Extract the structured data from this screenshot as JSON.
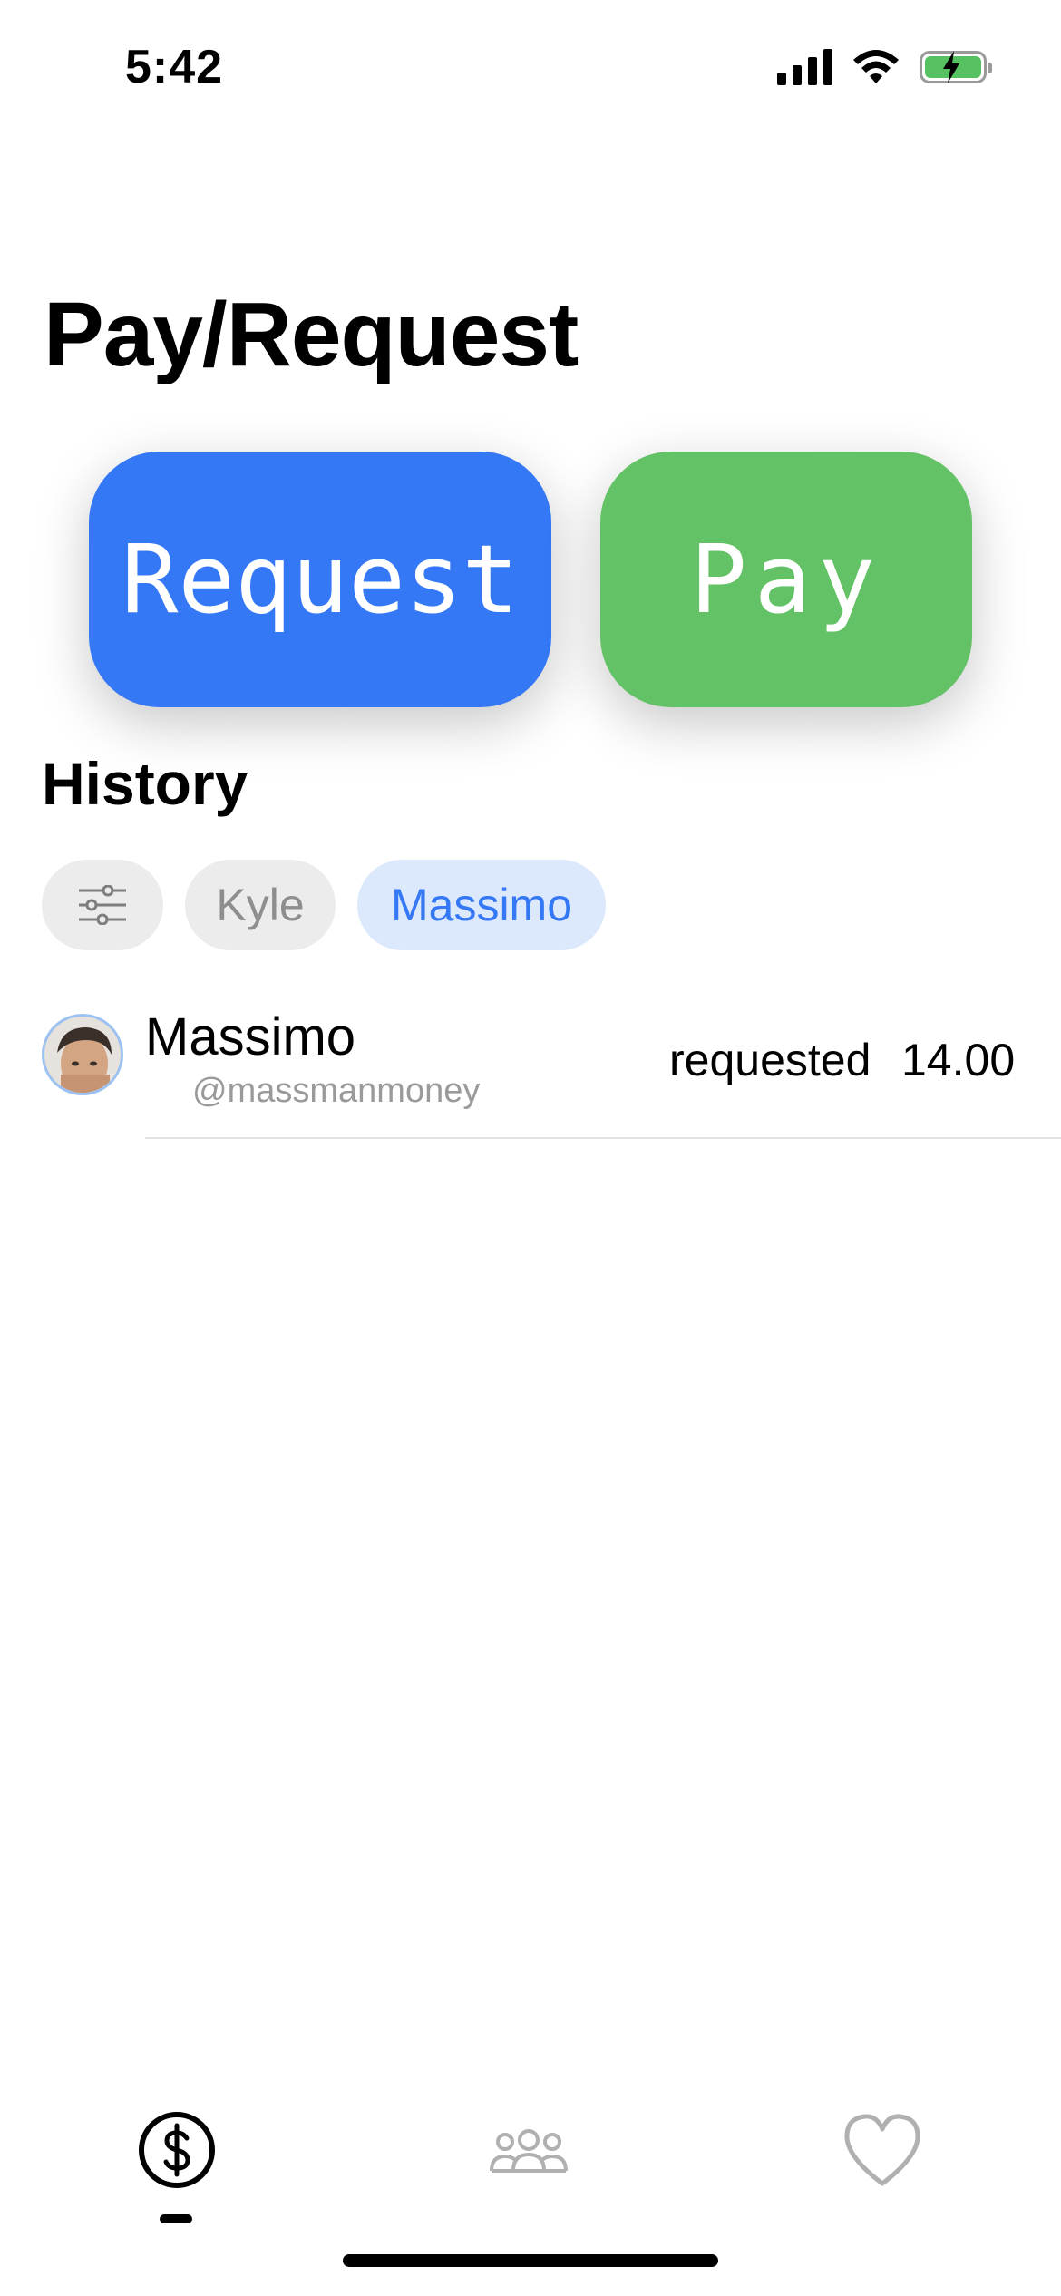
{
  "status_bar": {
    "time": "5:42",
    "icons": [
      "cellular-signal-icon",
      "wifi-icon",
      "battery-charging-icon"
    ],
    "battery_color": "#56c161"
  },
  "header": {
    "title": "Pay/Request"
  },
  "actions": {
    "request_label": "Request",
    "request_color": "#3478f6",
    "pay_label": "Pay",
    "pay_color": "#63c266"
  },
  "history": {
    "title": "History",
    "filters": [
      {
        "icon": "sliders-icon",
        "selected": false
      },
      {
        "label": "Kyle",
        "selected": false
      },
      {
        "label": "Massimo",
        "selected": true
      }
    ],
    "items": [
      {
        "name": "Massimo",
        "handle": "@massmanmoney",
        "action": "requested",
        "amount": "14.00"
      }
    ]
  },
  "tab_bar": {
    "tabs": [
      {
        "icon": "dollar-circle-icon",
        "selected": true
      },
      {
        "icon": "people-icon",
        "selected": false
      },
      {
        "icon": "heart-icon",
        "selected": false
      }
    ]
  }
}
